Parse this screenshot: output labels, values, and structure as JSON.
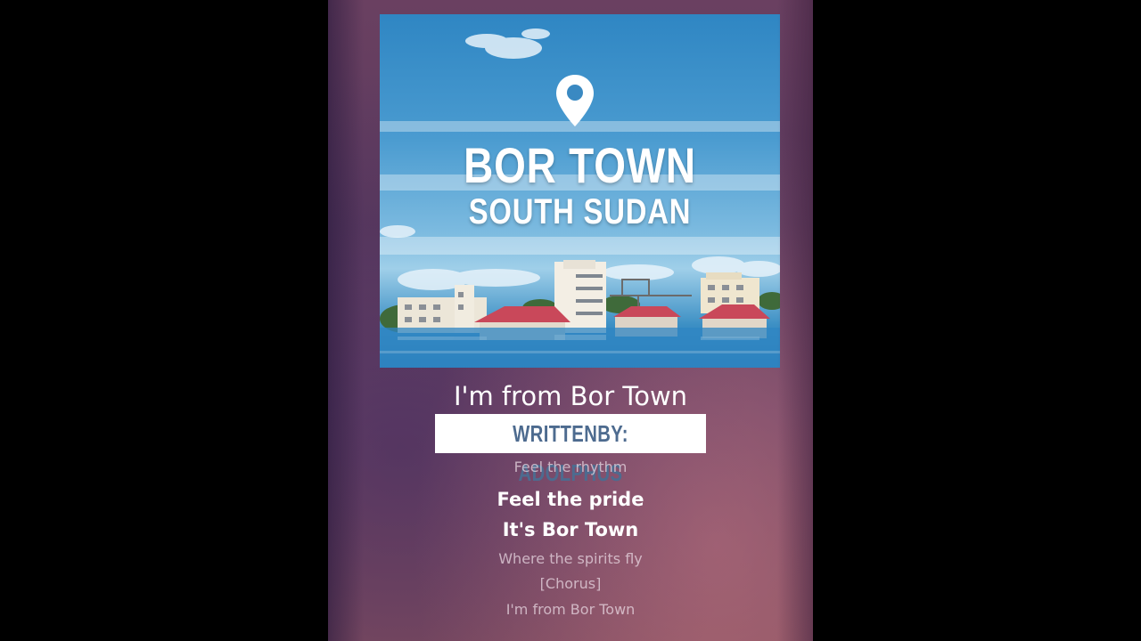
{
  "album_art": {
    "title_line1": "BOR TOWN",
    "title_line2": "SOUTH SUDAN",
    "icon": "location-pin-icon"
  },
  "song": {
    "title": "I'm from Bor Town",
    "written_by": "WRITTENBY: ADOLPHUS"
  },
  "lyrics": [
    {
      "text": "Feel the rhythm",
      "active": false
    },
    {
      "text": "Feel the pride",
      "active": true
    },
    {
      "text": "It's Bor Town",
      "active": true
    },
    {
      "text": "Where the spirits fly",
      "active": false
    },
    {
      "text": "[Chorus]",
      "active": false
    },
    {
      "text": "I'm from Bor Town",
      "active": false
    }
  ],
  "colors": {
    "background": "#000000",
    "panel_top": "#6a4061",
    "panel_bottom": "#86505f",
    "writer_text": "#4d6b8f",
    "sky": "#4a9bd0"
  }
}
